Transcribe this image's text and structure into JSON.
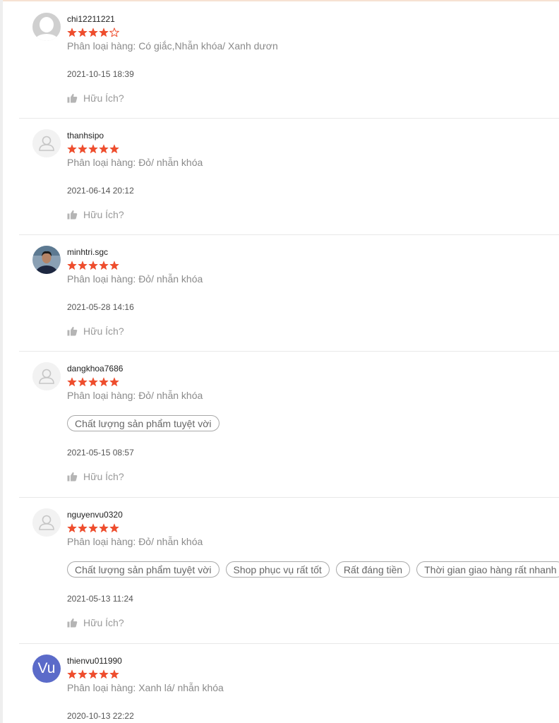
{
  "colors": {
    "star": "#ee4d2d",
    "avatar_initials_bg": "#5b6bc9"
  },
  "reviews": [
    {
      "username": "chi12211221",
      "rating": 4,
      "avatar": "photo-gray",
      "variation": "Phân loại hàng: Có giắc,Nhẫn khóa/ Xanh dươn",
      "tags": [],
      "timestamp": "2021-10-15 18:39",
      "helpful": "Hữu Ích?"
    },
    {
      "username": "thanhsipo",
      "rating": 5,
      "avatar": "default",
      "variation": "Phân loại hàng: Đỏ/ nhẫn khóa",
      "tags": [],
      "timestamp": "2021-06-14 20:12",
      "helpful": "Hữu Ích?"
    },
    {
      "username": "minhtri.sgc",
      "rating": 5,
      "avatar": "photo-person",
      "variation": "Phân loại hàng: Đỏ/ nhẫn khóa",
      "tags": [],
      "timestamp": "2021-05-28 14:16",
      "helpful": "Hữu Ích?"
    },
    {
      "username": "dangkhoa7686",
      "rating": 5,
      "avatar": "default",
      "variation": "Phân loại hàng: Đỏ/ nhẫn khóa",
      "tags": [
        "Chất lượng sản phẩm tuyệt vời"
      ],
      "timestamp": "2021-05-15 08:57",
      "helpful": "Hữu Ích?"
    },
    {
      "username": "nguyenvu0320",
      "rating": 5,
      "avatar": "default",
      "variation": "Phân loại hàng: Đỏ/ nhẫn khóa",
      "tags": [
        "Chất lượng sản phẩm tuyệt vời",
        "Shop phục vụ rất tốt",
        "Rất đáng tiền",
        "Thời gian giao hàng rất nhanh"
      ],
      "timestamp": "2021-05-13 11:24",
      "helpful": "Hữu Ích?"
    },
    {
      "username": "thienvu011990",
      "rating": 5,
      "avatar": "initials",
      "avatar_text": "Vu",
      "variation": "Phân loại hàng: Xanh lá/ nhẫn khóa",
      "tags": [],
      "timestamp": "2020-10-13 22:22",
      "helpful": ""
    }
  ]
}
